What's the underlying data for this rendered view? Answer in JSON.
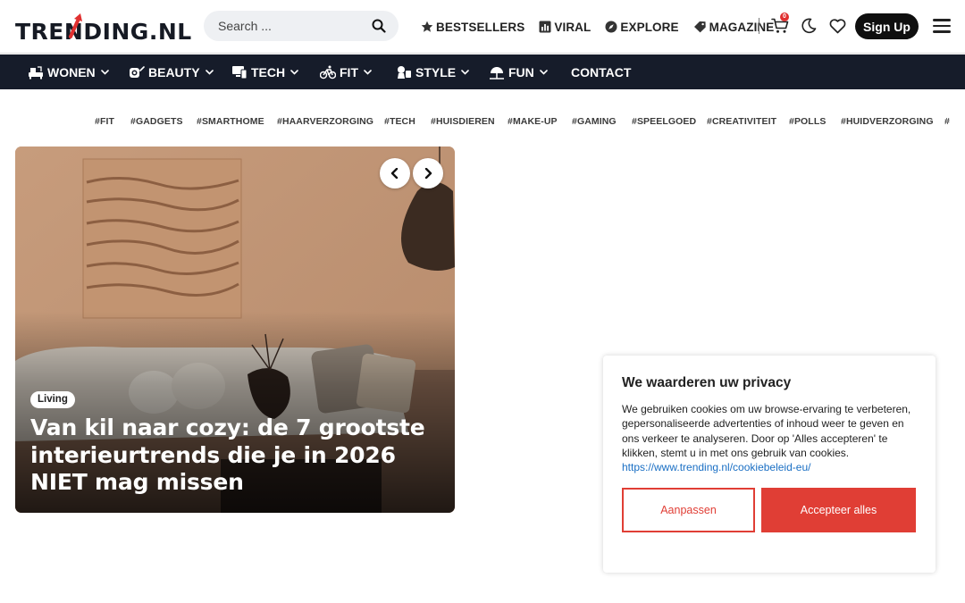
{
  "header": {
    "logo_prefix": "TRE",
    "logo_n": "N",
    "logo_suffix": "DING.NL",
    "search_placeholder": "Search ...",
    "nav": [
      {
        "label": "BESTSELLERS",
        "icon": "star-icon"
      },
      {
        "label": "VIRAL",
        "icon": "chart-icon"
      },
      {
        "label": "EXPLORE",
        "icon": "compass-icon"
      },
      {
        "label": "MAGAZINE",
        "icon": "tag-icon"
      }
    ],
    "cart_count": "0",
    "signup_label": "Sign Up"
  },
  "categories": [
    {
      "label": "WONEN",
      "icon": "home-icon"
    },
    {
      "label": "BEAUTY",
      "icon": "beauty-icon"
    },
    {
      "label": "TECH",
      "icon": "tech-icon"
    },
    {
      "label": "FIT",
      "icon": "fitness-icon"
    },
    {
      "label": "STYLE",
      "icon": "style-icon"
    },
    {
      "label": "FUN",
      "icon": "fun-icon"
    },
    {
      "label": "CONTACT",
      "icon": ""
    }
  ],
  "tags": [
    "#FIT",
    "#GADGETS",
    "#SMARTHOME",
    "#HAARVERZORGING",
    "#TECH",
    "#HUISDIEREN",
    "#MAKE-UP",
    "#GAMING",
    "#SPEELGOED",
    "#CREATIVITEIT",
    "#POLLS",
    "#HUIDVERZORGING",
    "#"
  ],
  "hero": {
    "category": "Living",
    "title": "Van kil naar cozy: de 7 grootste interieurtrends die je in 2026 NIET mag missen"
  },
  "cookie": {
    "title": "We waarderen uw privacy",
    "text": "We gebruiken cookies om uw browse-ervaring te verbeteren, gepersonaliseerde advertenties of inhoud weer te geven en ons verkeer te analyseren. Door op 'Alles accepteren' te klikken, stemt u in met ons gebruik van cookies.",
    "link": "https://www.trending.nl/cookiebeleid-eu/",
    "customize_label": "Aanpassen",
    "accept_label": "Accepteer alles"
  },
  "colors": {
    "accent": "#e03e35",
    "navbar": "#161c2a",
    "logo_arrow": "#e03030"
  }
}
